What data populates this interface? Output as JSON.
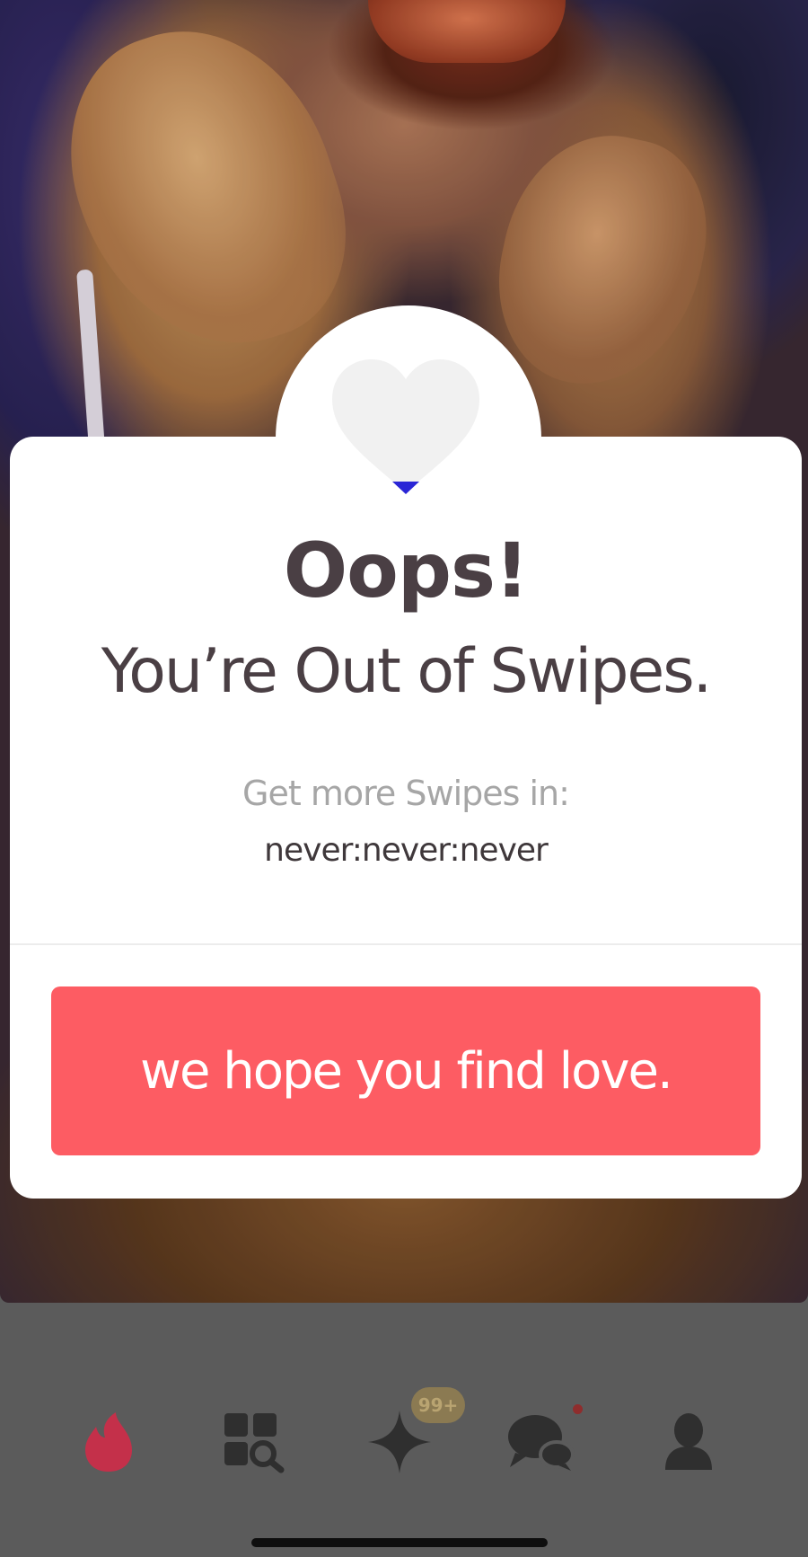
{
  "modal": {
    "title": "Oops!",
    "subtitle": "You’re Out of Swipes.",
    "get_more_label": "Get more Swipes in:",
    "countdown": "never:never:never",
    "cta_label": "we hope you find love."
  },
  "bottom_nav": {
    "items": [
      {
        "icon": "flame-icon"
      },
      {
        "icon": "explore-icon"
      },
      {
        "icon": "spark-icon",
        "badge": "99+"
      },
      {
        "icon": "messages-icon"
      },
      {
        "icon": "profile-icon"
      }
    ]
  },
  "colors": {
    "cta": "#fd5c63",
    "title_text": "#4a3f44",
    "muted_text": "#a6a6a6",
    "flame": "#c4304a"
  }
}
